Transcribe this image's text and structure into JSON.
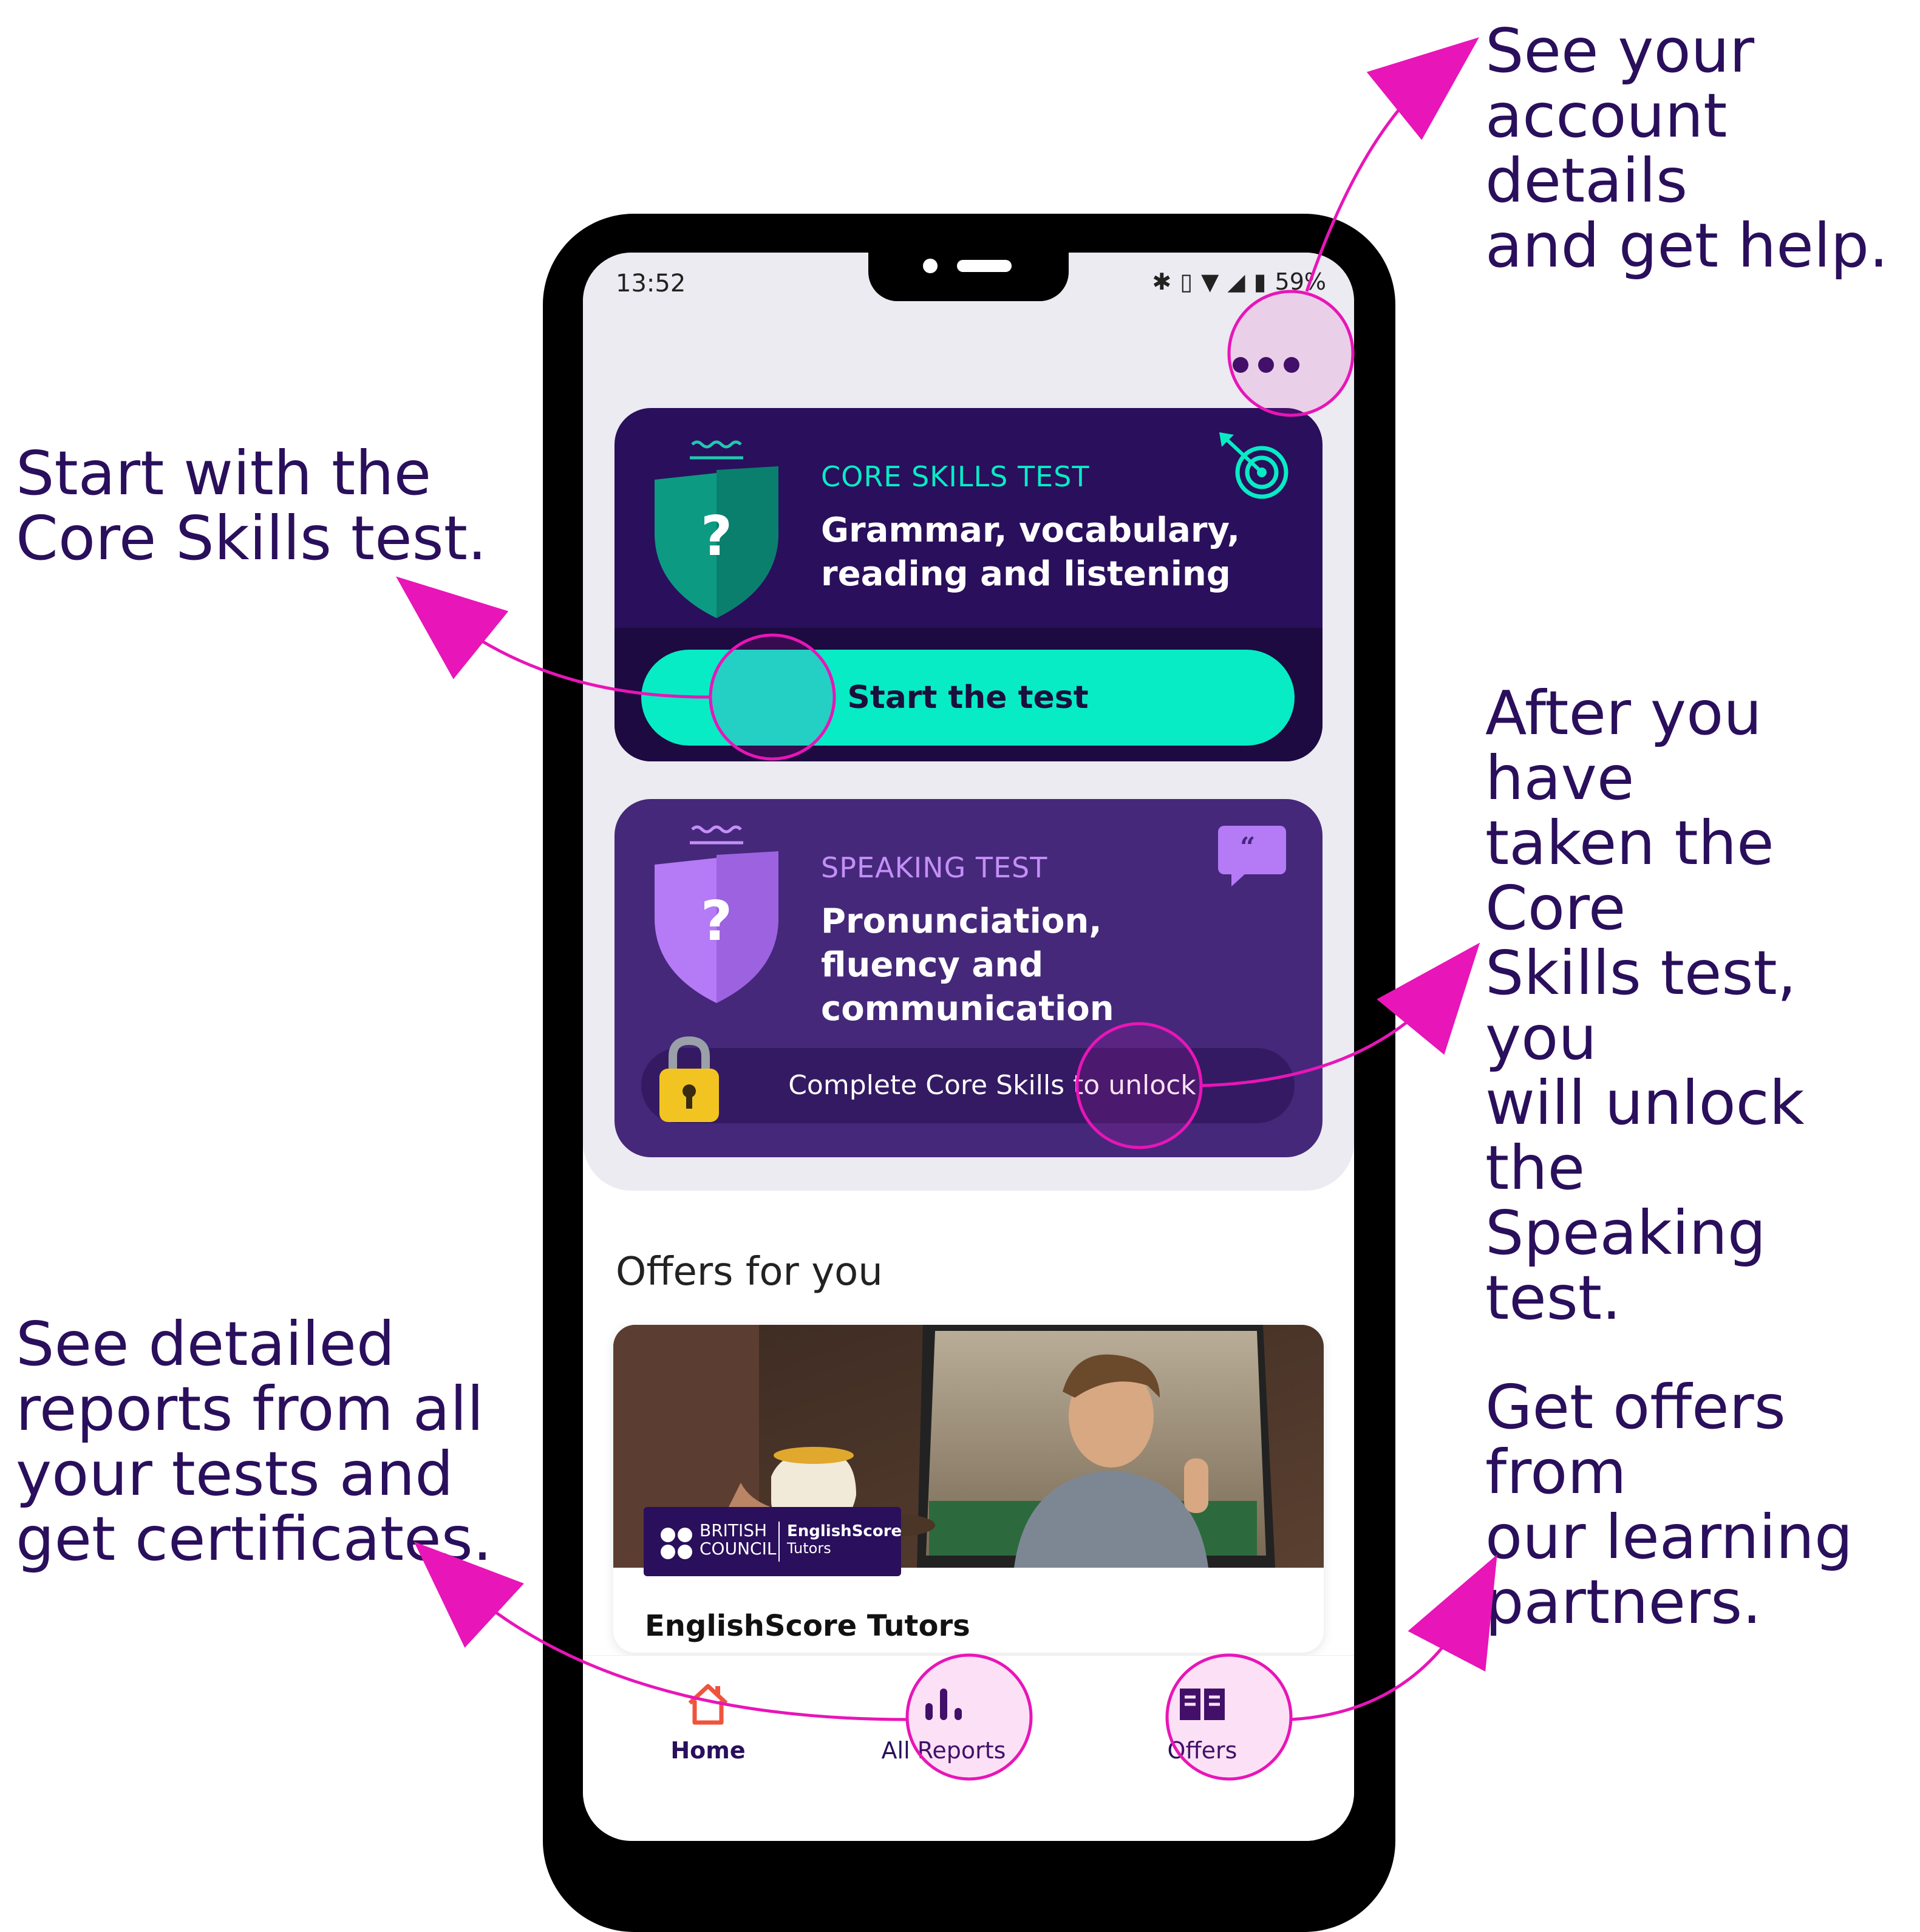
{
  "annotations": {
    "account": "See your\naccount details\nand get help.",
    "core": "Start with the\nCore Skills test.",
    "speaking": "After you have\ntaken the Core\nSkills test, you\nwill unlock the\nSpeaking test.",
    "reports": "See detailed\nreports from all\nyour tests and\nget certificates.",
    "offers": "Get offers from\nour learning\npartners."
  },
  "status_bar": {
    "time": "13:52",
    "battery": "59%"
  },
  "core_card": {
    "label": "CORE SKILLS TEST",
    "description": "Grammar, vocabulary, reading and listening",
    "button": "Start the test",
    "shield_glyph": "?",
    "icon": "target-icon",
    "accent": "#07ecc5"
  },
  "speaking_card": {
    "label": "SPEAKING TEST",
    "description": "Pronunciation, fluency and communication",
    "lock_text": "Complete Core Skills to unlock",
    "shield_glyph": "?",
    "icon": "speech-quote-icon",
    "accent": "#b57af5"
  },
  "offers": {
    "title": "Offers for you",
    "card_name": "EnglishScore Tutors",
    "badge_left_line1": "BRITISH",
    "badge_left_line2": "COUNCIL",
    "badge_right_line1": "EnglishScore",
    "badge_right_line2": "Tutors"
  },
  "nav": {
    "home": "Home",
    "reports": "All Reports",
    "offers": "Offers"
  },
  "colors": {
    "brand": "#2a0f5c",
    "highlight": "#e815b8",
    "home_icon": "#f0533c"
  }
}
